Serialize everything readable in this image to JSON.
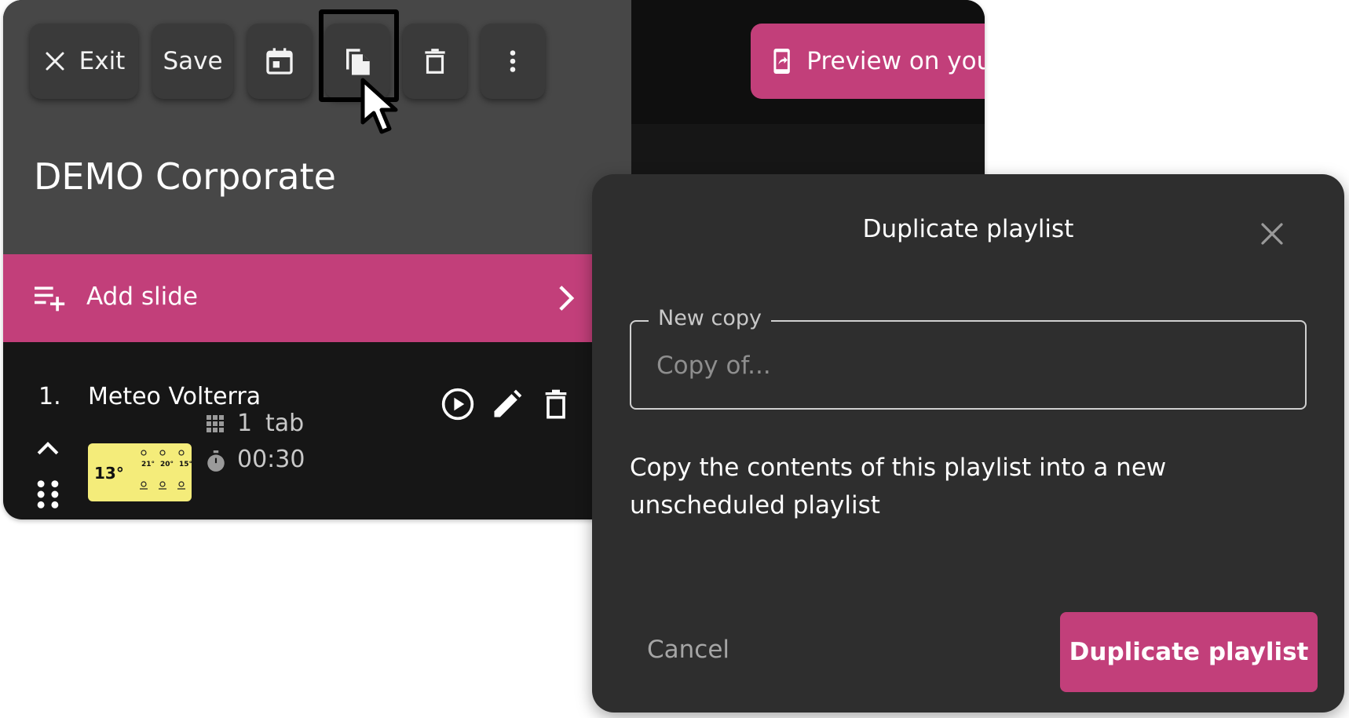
{
  "toolbar": {
    "exit_label": "Exit",
    "save_label": "Save",
    "preview_label": "Preview on your"
  },
  "playlist": {
    "title": "DEMO Corporate",
    "add_slide_label": "Add slide"
  },
  "slides": [
    {
      "number": "1.",
      "name": "Meteo Volterra",
      "tabs_count": "1",
      "tabs_label": "tab",
      "duration": "00:30",
      "thumbnail": {
        "temperature": "13°",
        "forecast_temps": [
          "21°",
          "20°",
          "15°"
        ]
      }
    }
  ],
  "modal": {
    "title": "Duplicate playlist",
    "field_legend": "New copy",
    "field_placeholder": "Copy of...",
    "field_value": "",
    "description": "Copy the contents of this playlist into a new unscheduled playlist",
    "cancel_label": "Cancel",
    "confirm_label": "Duplicate playlist"
  },
  "colors": {
    "accent": "#c23f7a",
    "header_bg": "#474747",
    "button_bg": "#3a3a3a",
    "modal_bg": "#2e2e2e",
    "thumbnail_bg": "#f4ec7a"
  },
  "icons": [
    "close-icon",
    "calendar-icon",
    "copy-icon",
    "trash-icon",
    "more-vert-icon",
    "phone-share-icon",
    "playlist-add-icon",
    "chevron-right-icon",
    "play-circle-icon",
    "pencil-icon",
    "chevron-up-icon",
    "drag-handle-icon",
    "grid-icon",
    "timer-icon",
    "cursor-icon"
  ]
}
